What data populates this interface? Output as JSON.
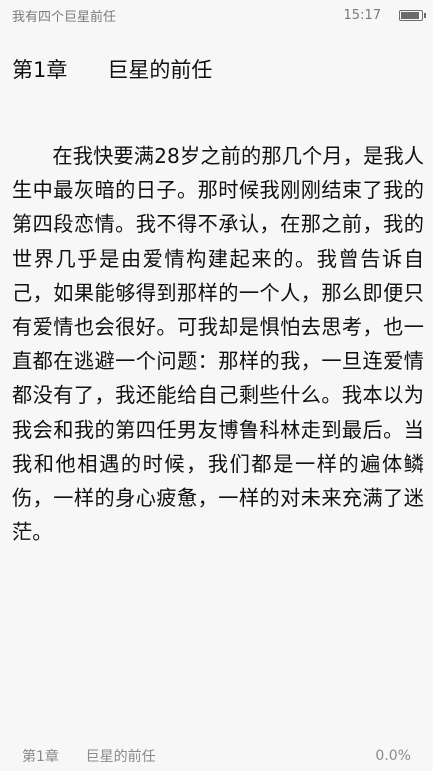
{
  "status_bar": {
    "book_title": "我有四个巨星前任",
    "time": "15:17",
    "battery_level": 0.9
  },
  "chapter": {
    "title": "第1章      巨星的前任"
  },
  "content": {
    "paragraph": "在我快要满28岁之前的那几个月，是我人生中最灰暗的日子。那时候我刚刚结束了我的第四段恋情。我不得不承认，在那之前，我的世界几乎是由爱情构建起来的。我曾告诉自己，如果能够得到那样的一个人，那么即便只有爱情也会很好。可我却是惧怕去思考，也一直都在逃避一个问题：那样的我，一旦连爱情都没有了，我还能给自己剩些什么。我本以为我会和我的第四任男友博鲁科林走到最后。当我和他相遇的时候，我们都是一样的遍体鳞伤，一样的身心疲惫，一样的对未来充满了迷茫。"
  },
  "footer": {
    "chapter_label": "第1章      巨星的前任",
    "progress": "0.0%"
  }
}
